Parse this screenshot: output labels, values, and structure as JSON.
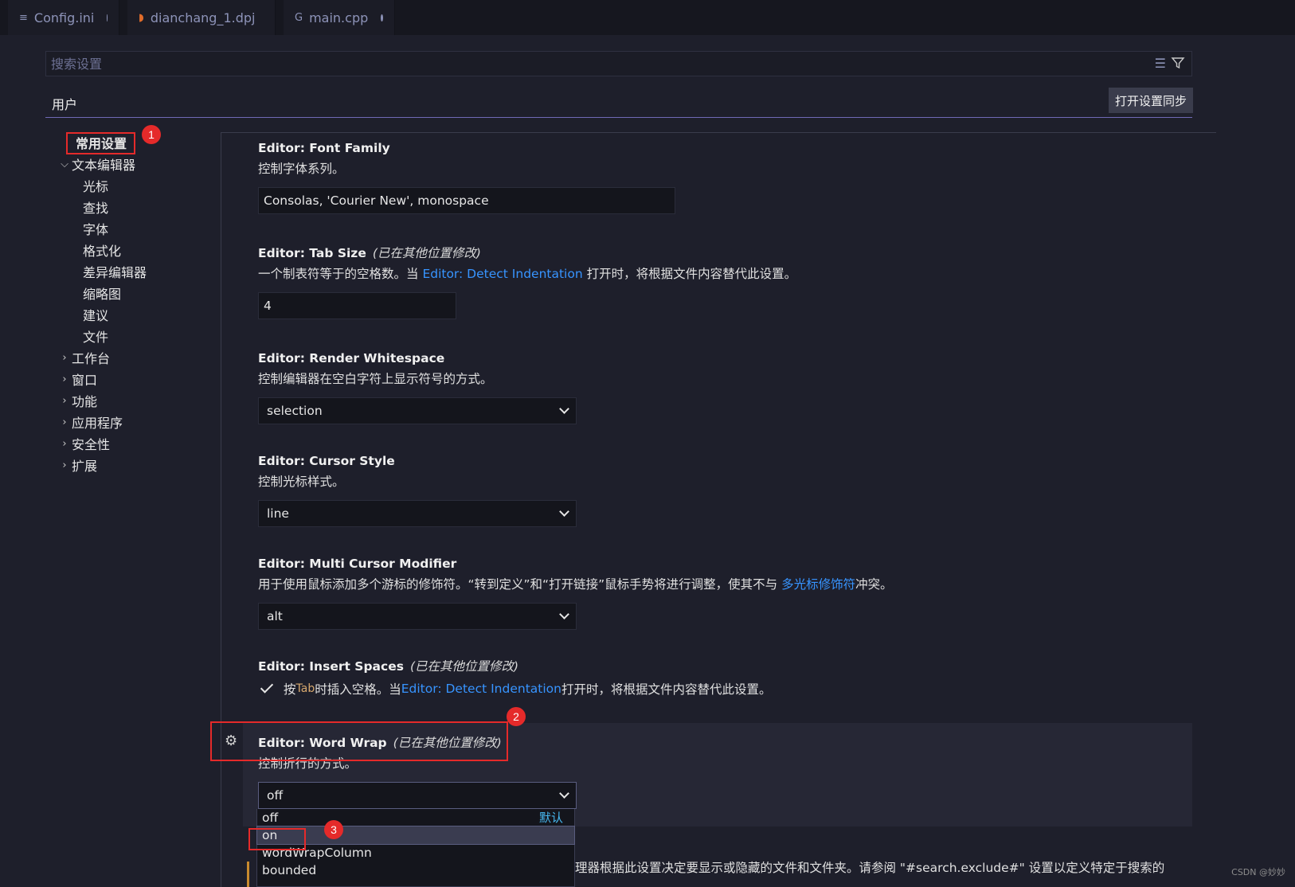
{
  "tabs": [
    {
      "label": "Config.ini",
      "icon": "lines-icon"
    },
    {
      "label": "dianchang_1.dpj",
      "icon": "rss-icon"
    },
    {
      "label": "main.cpp",
      "icon": "cpp-icon"
    }
  ],
  "search": {
    "placeholder": "搜索设置"
  },
  "header": {
    "user_tab": "用户",
    "sync_button": "打开设置同步"
  },
  "toc": {
    "common": "常用设置",
    "text_editor": "文本编辑器",
    "sub": [
      "光标",
      "查找",
      "字体",
      "格式化",
      "差异编辑器",
      "缩略图",
      "建议",
      "文件"
    ],
    "groups": [
      "工作台",
      "窗口",
      "功能",
      "应用程序",
      "安全性",
      "扩展"
    ]
  },
  "settings": {
    "font_family": {
      "title": "Editor: Font Family",
      "desc": "控制字体系列。",
      "value": "Consolas, 'Courier New', monospace"
    },
    "tab_size": {
      "title": "Editor: Tab Size",
      "modified": "(已在其他位置修改)",
      "desc_pre": "一个制表符等于的空格数。当 ",
      "link": "Editor: Detect Indentation",
      "desc_post": " 打开时，将根据文件内容替代此设置。",
      "value": "4"
    },
    "render_whitespace": {
      "title": "Editor: Render Whitespace",
      "desc": "控制编辑器在空白字符上显示符号的方式。",
      "value": "selection"
    },
    "cursor_style": {
      "title": "Editor: Cursor Style",
      "desc": "控制光标样式。",
      "value": "line"
    },
    "multi_cursor": {
      "title": "Editor: Multi Cursor Modifier",
      "desc_pre": "用于使用鼠标添加多个游标的修饰符。“转到定义”和“打开链接”鼠标手势将进行调整，使其不与 ",
      "link": "多光标修饰符",
      "desc_post": "冲突。",
      "value": "alt"
    },
    "insert_spaces": {
      "title": "Editor: Insert Spaces",
      "modified": "(已在其他位置修改)",
      "desc_pre": "按 ",
      "code": "Tab",
      "desc_mid": " 时插入空格。当 ",
      "link": "Editor: Detect Indentation",
      "desc_post": " 打开时，将根据文件内容替代此设置。"
    },
    "word_wrap": {
      "title": "Editor: Word Wrap",
      "modified": "(已在其他位置修改)",
      "desc": "控制折行的方式。",
      "value": "off",
      "options": [
        "off",
        "on",
        "wordWrapColumn",
        "bounded"
      ],
      "default_label": "默认"
    }
  },
  "cutoff_text": "理器根据此设置决定要显示或隐藏的文件和文件夹。请参阅 \"#search.exclude#\" 设置以定义特定于搜索的",
  "annotations": [
    "1",
    "2",
    "3"
  ],
  "watermark": "CSDN @妙妙",
  "colors": {
    "accent": "#6f69b5",
    "link": "#3794ff",
    "annotation": "#e52a2a"
  }
}
